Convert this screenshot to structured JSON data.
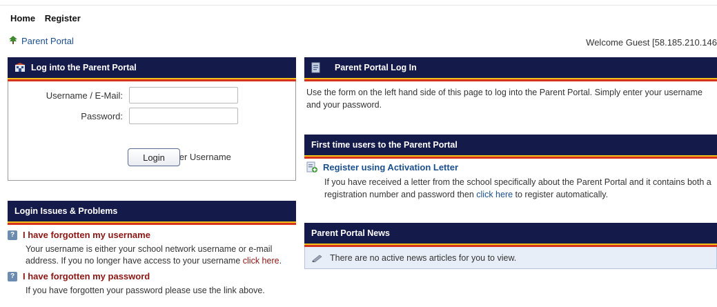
{
  "nav": {
    "items": [
      "Home",
      "Register"
    ]
  },
  "breadcrumb": {
    "label": "Parent Portal"
  },
  "welcome": "Welcome Guest [58.185.210.146",
  "login_panel": {
    "title": "Log into the Parent Portal",
    "username_label": "Username / E-Mail:",
    "username_value": "",
    "password_label": "Password:",
    "password_value": "",
    "remember_label": "Remember Username",
    "remember_checked": false,
    "login_button": "Login"
  },
  "issues_panel": {
    "title": "Login Issues & Problems",
    "items": [
      {
        "title": "I have forgotten my username",
        "text": "Your username is either your school network username or e-mail address. If you no longer have access to your username ",
        "link": "click here",
        "text_after": "."
      },
      {
        "title": "I have forgotten my password",
        "text": "If you have forgotten your password please use the link above."
      }
    ]
  },
  "portal_login_panel": {
    "title": "Parent Portal Log In",
    "text": "Use the form on the left hand side of this page to log into the Parent Portal. Simply enter your username and your password."
  },
  "first_time_panel": {
    "title": "First time users to the Parent Portal",
    "register_title": "Register using Activation Letter",
    "text_before": "If you have received a letter from the school specifically about the Parent Portal and it contains both a registration number and password then ",
    "link": "click here",
    "text_after": " to register automatically."
  },
  "news_panel": {
    "title": "Parent Portal News",
    "empty_text": "There are no active news articles for you to view."
  },
  "colors": {
    "header_bg": "#141a4a",
    "header_stripe_yellow": "#f3c319",
    "header_stripe_red": "#d6321c",
    "link_blue": "#1b4f8c",
    "link_red": "#8a1512",
    "news_bg": "#e8eef8"
  },
  "icons": {
    "breadcrumb": "tree-icon",
    "login_header": "building-icon",
    "portal_login_header": "document-icon",
    "issue": "question-icon",
    "register": "document-add-icon",
    "news": "pencil-icon"
  }
}
